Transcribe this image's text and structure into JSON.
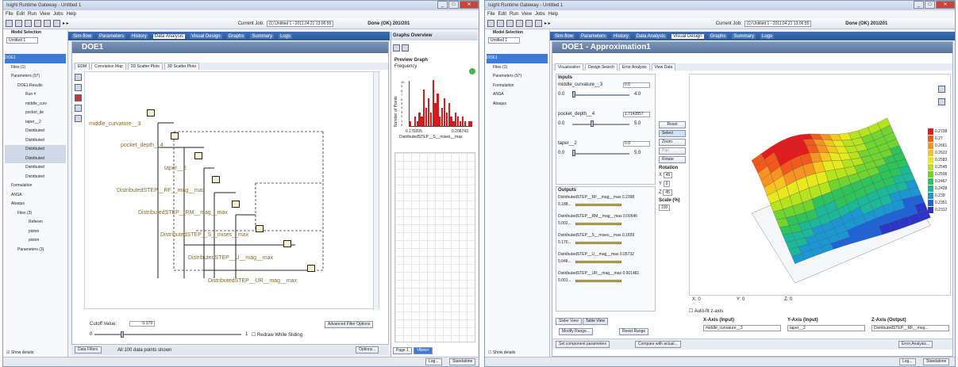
{
  "left_window": {
    "title": "Isight Runtime Gateway - Untitled 1",
    "menu": [
      "File",
      "Edit",
      "Run",
      "View",
      "Jobs",
      "Help"
    ],
    "current_job_label": "Current Job:",
    "current_job_value": "(1) Untitled 1 - 2011.04.21 13:06:55",
    "status": "Done (OK) 201/201",
    "model_selection_label": "Model Selection",
    "model_selection_value": "Untitled 1",
    "tree": [
      "DOE1",
      "Files (1)",
      "Parameters (97)",
      "DOE1.Results",
      "Run #",
      "middle_curv",
      "pocket_de",
      "taper__2",
      "Distributed",
      "Distributed",
      "Distributed",
      "Distributed",
      "Distributed",
      "Distributed",
      "Formulation",
      "ANSA",
      "Abaqus",
      "Files (3)",
      "Referen",
      "piston",
      "piston",
      "Parameters (3)"
    ],
    "show_details": "Show details",
    "tabs": [
      "Sim-flow",
      "Parameters",
      "History",
      "Data Analysis",
      "Visual Design",
      "Graphs",
      "Summary",
      "Logs"
    ],
    "doc_title": "DOE1",
    "subtabs": [
      "EDM",
      "Correlation Map",
      "2D Scatter Plots",
      "3D Scatter Plots"
    ],
    "nodes": [
      "middle_curvature__3",
      "pocket_depth__4",
      "taper__2",
      "DistributedSTEP__RF__mag__max",
      "DistributedSTEP__RM__mag__max",
      "DistributedSTEP__S__mises__max",
      "DistributedSTEP__U__mag__max",
      "DistributedSTEP__UR__mag__max"
    ],
    "cutoff_label": "Cutoff Value:",
    "cutoff_value": "0.179",
    "slider_min": "0",
    "slider_max": "1",
    "redraw_label": "Redraw While Sliding",
    "advanced_filter": "Advanced Filter Options",
    "data_filters": "Data Filters",
    "all_points": "All 100 data points shown",
    "options": "Options...",
    "graphs_overview": "Graphs Overview",
    "preview_graph": "Preview Graph",
    "frequency": "Frequency",
    "hist_ylabel": "Number of Points",
    "hist_yticks": [
      "10",
      "9",
      "8",
      "7",
      "6",
      "5",
      "4",
      "3",
      "2",
      "1",
      "0"
    ],
    "hist_xmin": "0.170205",
    "hist_xmax": "0.208743",
    "hist_xlabel": "DistributedSTEP__S__mises__max",
    "page1": "Page 1",
    "new_tab": "<New>",
    "log": "Log...",
    "standalone": "Standalone"
  },
  "right_window": {
    "title": "Isight Runtime Gateway - Untitled 1",
    "menu": [
      "File",
      "Edit",
      "Run",
      "View",
      "Jobs",
      "Help"
    ],
    "current_job_label": "Current Job:",
    "current_job_value": "(1) Untitled 1 - 2011.04.21 13:06:55",
    "status": "Done (OK) 201/201",
    "model_selection_label": "Model Selection",
    "model_selection_value": "Untitled 1",
    "tree": [
      "DOE1",
      "Files (1)",
      "Parameters (97)",
      "Formulation",
      "ANSA",
      "Abaqus"
    ],
    "show_details": "Show details",
    "tabs": [
      "Sim-flow",
      "Parameters",
      "History",
      "Data Analysis",
      "Visual Design",
      "Graphs",
      "Summary",
      "Logs"
    ],
    "doc_title": "DOE1 - Approximation1",
    "subtabs": [
      "Visualization",
      "Design Search",
      "Error Analysis",
      "View Data"
    ],
    "inputs_header": "Inputs",
    "inputs": [
      {
        "name": "middle_curvature__3",
        "value": "0.0",
        "min": "0.0",
        "max": "4.0",
        "pos": 0.0
      },
      {
        "name": "pocket_depth__4",
        "value": "1.7142857",
        "min": "0.0",
        "max": "5.0",
        "pos": 0.34
      },
      {
        "name": "taper__2",
        "value": "0.0",
        "min": "0.0",
        "max": "5.0",
        "pos": 0.0
      }
    ],
    "outputs_header": "Outputs",
    "outputs": [
      {
        "name": "DistributedSTEP__RF__mag__max",
        "value": "0.2398",
        "low": "0.188..."
      },
      {
        "name": "DistributedSTEP__RM__mag__max",
        "value": "0.00646",
        "low": "0.002..."
      },
      {
        "name": "DistributedSTEP__S__mises__max",
        "value": "0.1839",
        "low": "0.170..."
      },
      {
        "name": "DistributedSTEP__U__mag__max",
        "value": "0.05732",
        "low": "0.048..."
      },
      {
        "name": "DistributedSTEP__UR__mag__max",
        "value": "0.001481",
        "low": "0.001..."
      }
    ],
    "slider_view": "Slider View",
    "table_view": "Table View",
    "modify_range": "Modify Range...",
    "reset_range": "Reset Range",
    "reset": "Reset",
    "select": "Select",
    "zoom": "Zoom",
    "pan": "Pan",
    "rotate": "Rotate",
    "rotation": "Rotation",
    "rot_x_label": "X",
    "rot_x": "45",
    "rot_y_label": "Y",
    "rot_y": "0",
    "rot_z_label": "Z",
    "rot_z": "45",
    "scale_label": "Scale (%)",
    "scale": "100",
    "coord_x": "X: 0",
    "coord_y": "Y: 0",
    "coord_z": "Z: 0",
    "auto_fit": "Auto-fit z-axis",
    "x_axis_label": "X-Axis (Input)",
    "x_axis_value": "middle_curvature__3",
    "y_axis_label": "Y-Axis (Input)",
    "y_axis_value": "taper__2",
    "z_axis_label": "Z-Axis (Output)",
    "z_axis_value": "DistributedSTEP__RF__mag...",
    "set_params": "Set component parameters",
    "compare": "Compare with actual...",
    "error_analysis": "Error Analysis...",
    "legend": [
      "0.2738",
      "0.27",
      "0.2661",
      "0.2622",
      "0.2583",
      "0.2545",
      "0.2506",
      "0.2467",
      "0.2428",
      "0.239",
      "0.2351",
      "0.2312"
    ],
    "legend_colors": [
      "#e41a1c",
      "#f2591a",
      "#f79320",
      "#f7c51e",
      "#e8e91c",
      "#b5e41f",
      "#70d431",
      "#2fc45b",
      "#1bb89a",
      "#1b97d3",
      "#1e64d8",
      "#2c35c8"
    ],
    "log": "Log...",
    "standalone": "Standalone"
  }
}
